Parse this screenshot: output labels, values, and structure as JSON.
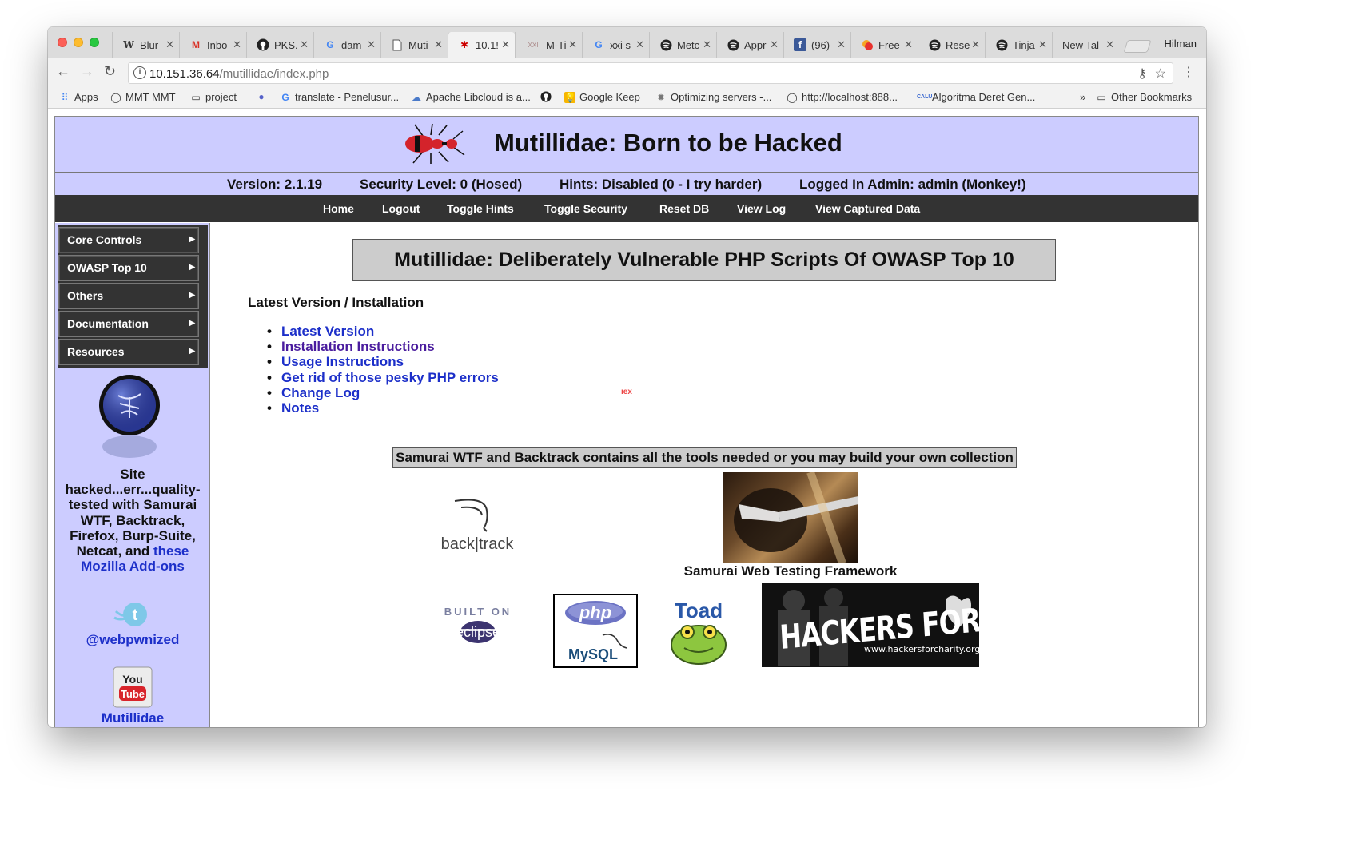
{
  "browser": {
    "profile": "Hilman",
    "tabs": [
      {
        "label": "Blur",
        "favicon": "W"
      },
      {
        "label": "Inbo",
        "favicon": "M"
      },
      {
        "label": "PKS.",
        "favicon": "github-icon"
      },
      {
        "label": "dam",
        "favicon": "G"
      },
      {
        "label": "Muti",
        "favicon": "document-icon"
      },
      {
        "label": "10.1!",
        "favicon": "ant-icon"
      },
      {
        "label": "M-Ti",
        "favicon": "XXI"
      },
      {
        "label": "xxi s",
        "favicon": "G"
      },
      {
        "label": "Metc",
        "favicon": "spotify-icon"
      },
      {
        "label": "Appr",
        "favicon": "spotify-icon"
      },
      {
        "label": "(96)",
        "favicon": "facebook-icon"
      },
      {
        "label": "Free",
        "favicon": "free-icon"
      },
      {
        "label": "Rese",
        "favicon": "spotify-icon"
      },
      {
        "label": "Tinja",
        "favicon": "spotify-icon"
      },
      {
        "label": "New Tal",
        "favicon": ""
      }
    ],
    "url_host": "10.151.36.64",
    "url_path": "/mutillidae/index.php",
    "bookmarks": [
      {
        "label": "Apps",
        "icon": "apps-icon"
      },
      {
        "label": "MMT MMT",
        "icon": "github-icon"
      },
      {
        "label": "project",
        "icon": "folder-icon"
      },
      {
        "label": "",
        "icon": "globe-icon"
      },
      {
        "label": "translate - Penelusur...",
        "icon": "google-icon"
      },
      {
        "label": "Apache Libcloud is a...",
        "icon": "libcloud-icon"
      },
      {
        "label": "",
        "icon": "github-icon"
      },
      {
        "label": "Google Keep",
        "icon": "keep-icon"
      },
      {
        "label": "Optimizing servers -...",
        "icon": "gear-icon"
      },
      {
        "label": "http://localhost:888...",
        "icon": "github-icon"
      },
      {
        "label": "Algoritma Deret Gen...",
        "icon": "calu-icon"
      }
    ],
    "bookmarks_overflow": "»",
    "other_bookmarks": "Other Bookmarks"
  },
  "site": {
    "title": "Mutillidae: Born to be Hacked",
    "version": "Version: 2.1.19",
    "security_level": "Security Level: 0 (Hosed)",
    "hints": "Hints: Disabled (0 - I try harder)",
    "logged_in": "Logged In Admin: admin (Monkey!)",
    "nav": [
      "Home",
      "Logout",
      "Toggle Hints",
      "Toggle Security",
      "Reset DB",
      "View Log",
      "View Captured Data"
    ]
  },
  "sidebar": {
    "menu": [
      "Core Controls",
      "OWASP Top 10",
      "Others",
      "Documentation",
      "Resources"
    ],
    "text_before": "Site hacked...err...quality-tested with Samurai WTF, Backtrack, Firefox, Burp-Suite, Netcat, and ",
    "addons_link": "these Mozilla Add-ons",
    "twitter": "@webpwnized",
    "youtube": "Mutillidae",
    "youtube_logo_top": "You",
    "youtube_logo_bottom": "Tube"
  },
  "main": {
    "headline": "Mutillidae: Deliberately Vulnerable PHP Scripts Of OWASP Top 10",
    "section_title": "Latest Version / Installation",
    "links": [
      "Latest Version",
      "Installation Instructions",
      "Usage Instructions",
      "Get rid of those pesky PHP errors",
      "Change Log",
      "Notes"
    ],
    "stray_text": "ıex",
    "tools_banner": "Samurai WTF and Backtrack contains all the tools needed or you may build your own collection",
    "backtrack_label": "back|track",
    "samurai_caption": "Samurai Web Testing Framework",
    "eclipse_top": "BUILT ON",
    "eclipse_bottom": "eclipse",
    "php_label": "php",
    "mysql_label": "MySQL",
    "toad_label": "Toad",
    "hfc_title": "HACKERS FOR CHARITY",
    "hfc_url": "www.hackersforcharity.org"
  },
  "colors": {
    "header_band": "#ccccff",
    "menubar": "#333333",
    "link": "#1c2fc9"
  }
}
